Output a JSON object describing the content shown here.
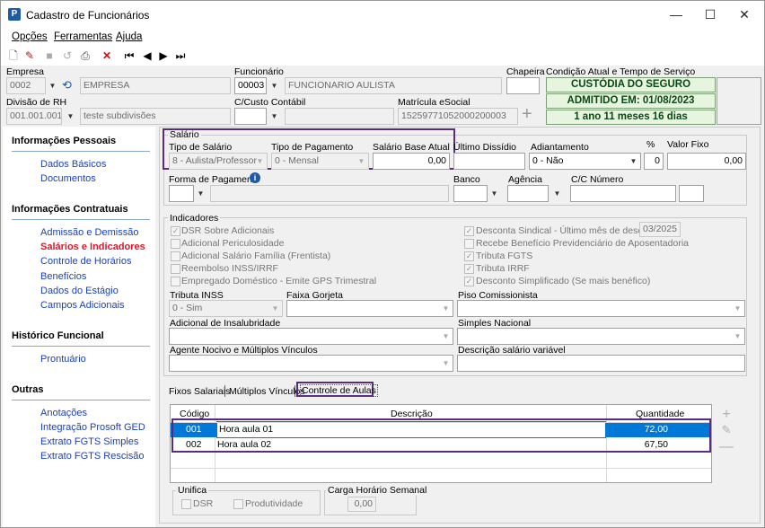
{
  "window": {
    "title": "Cadastro de Funcionários",
    "app_icon": "P",
    "minimize": "—",
    "maximize": "☐",
    "close": "✕"
  },
  "menu": [
    "Opções",
    "Ferramentas",
    "Ajuda"
  ],
  "header": {
    "empresa_label": "Empresa",
    "empresa_code": "0002",
    "empresa_name": "EMPRESA",
    "funcionario_label": "Funcionário",
    "funcionario_code": "00003",
    "funcionario_name": "FUNCIONARIO  AULISTA",
    "chapeira_label": "Chapeira",
    "chapeira_value": "",
    "condicao_label": "Condição Atual e Tempo de Serviço",
    "status1": "CUSTÓDIA DO SEGURO",
    "status2": "ADMITIDO EM: 01/08/2023",
    "status3": "1 ano 11 meses 16 dias",
    "divisao_label": "Divisão de RH",
    "divisao_code": "001.001.001",
    "divisao_name": "teste subdivisões",
    "ccusto_label": "C/Custo Contábil",
    "ccusto_value": "",
    "matricula_label": "Matrícula eSocial",
    "matricula_value": "15259771052000200003"
  },
  "sidebar": {
    "sections": [
      {
        "title": "Informações Pessoais",
        "items": [
          "Dados Básicos",
          "Documentos"
        ]
      },
      {
        "title": "Informações Contratuais",
        "items": [
          "Admissão e Demissão",
          "Salários e Indicadores",
          "Controle de Horários",
          "Benefícios",
          "Dados do Estágio",
          "Campos Adicionais"
        ]
      },
      {
        "title": "Histórico Funcional",
        "items": [
          "Prontuário"
        ]
      },
      {
        "title": "Outras",
        "items": [
          "Anotações",
          "Integração Prosoft GED",
          "Extrato FGTS Simples",
          "Extrato FGTS Rescisão"
        ]
      }
    ],
    "active": "Salários e Indicadores"
  },
  "salario": {
    "group_label": "Salário",
    "tipo_salario_label": "Tipo de Salário",
    "tipo_salario_value": "8 - Aulista/Professor",
    "tipo_pagamento_label": "Tipo de Pagamento",
    "tipo_pagamento_value": "0 - Mensal",
    "salario_base_label": "Salário Base Atual",
    "salario_base_value": "0,00",
    "ultimo_dissidio_label": "Último Dissídio",
    "ultimo_dissidio_value": "",
    "adiantamento_label": "Adiantamento",
    "adiantamento_value": "0 - Não",
    "pct_label": "%",
    "pct_value": "0",
    "valor_fixo_label": "Valor Fixo",
    "valor_fixo_value": "0,00",
    "forma_pagamento_label": "Forma de Pagamento",
    "banco_label": "Banco",
    "agencia_label": "Agência",
    "cc_label": "C/C Número"
  },
  "indicadores": {
    "group_label": "Indicadores",
    "left_checks": [
      {
        "label": "DSR Sobre Adicionais",
        "checked": true
      },
      {
        "label": "Adicional Periculosidade",
        "checked": false
      },
      {
        "label": "Adicional Salário Família (Frentista)",
        "checked": false
      },
      {
        "label": "Reembolso INSS/IRRF",
        "checked": false
      },
      {
        "label": "Empregado Doméstico - Emite GPS Trimestral",
        "checked": false
      }
    ],
    "right_checks": [
      {
        "label": "Desconta Sindical - Último mês de desconto",
        "checked": true
      },
      {
        "label": "Recebe Benefício Previdenciário de Aposentadoria",
        "checked": false
      },
      {
        "label": "Tributa FGTS",
        "checked": true
      },
      {
        "label": "Tributa IRRF",
        "checked": true
      },
      {
        "label": "Desconto Simplificado (Se mais benéfico)",
        "checked": true
      }
    ],
    "sindical_month": "03/2025",
    "tributa_inss_label": "Tributa INSS",
    "tributa_inss_value": "0 - Sim",
    "faixa_gorjeta_label": "Faixa Gorjeta",
    "piso_label": "Piso Comissionista",
    "insalubridade_label": "Adicional de Insalubridade",
    "simples_label": "Simples Nacional",
    "agente_label": "Agente Nocivo e  Múltiplos Vínculos",
    "descricao_var_label": "Descrição salário variável"
  },
  "tabs": [
    "Fixos Salariais",
    "Múltiplos Vínculos",
    "Controle de Aulas"
  ],
  "aulas": {
    "headers": [
      "Código",
      "Descrição",
      "Quantidade"
    ],
    "rows": [
      {
        "codigo": "001",
        "descricao": "Hora aula 01",
        "quantidade": "72,00"
      },
      {
        "codigo": "002",
        "descricao": "Hora aula 02",
        "quantidade": "67,50"
      }
    ]
  },
  "unifica": {
    "label": "Unifica",
    "dsr": "DSR",
    "produtividade": "Produtividade"
  },
  "carga": {
    "label": "Carga Horário Semanal",
    "value": "0,00"
  }
}
